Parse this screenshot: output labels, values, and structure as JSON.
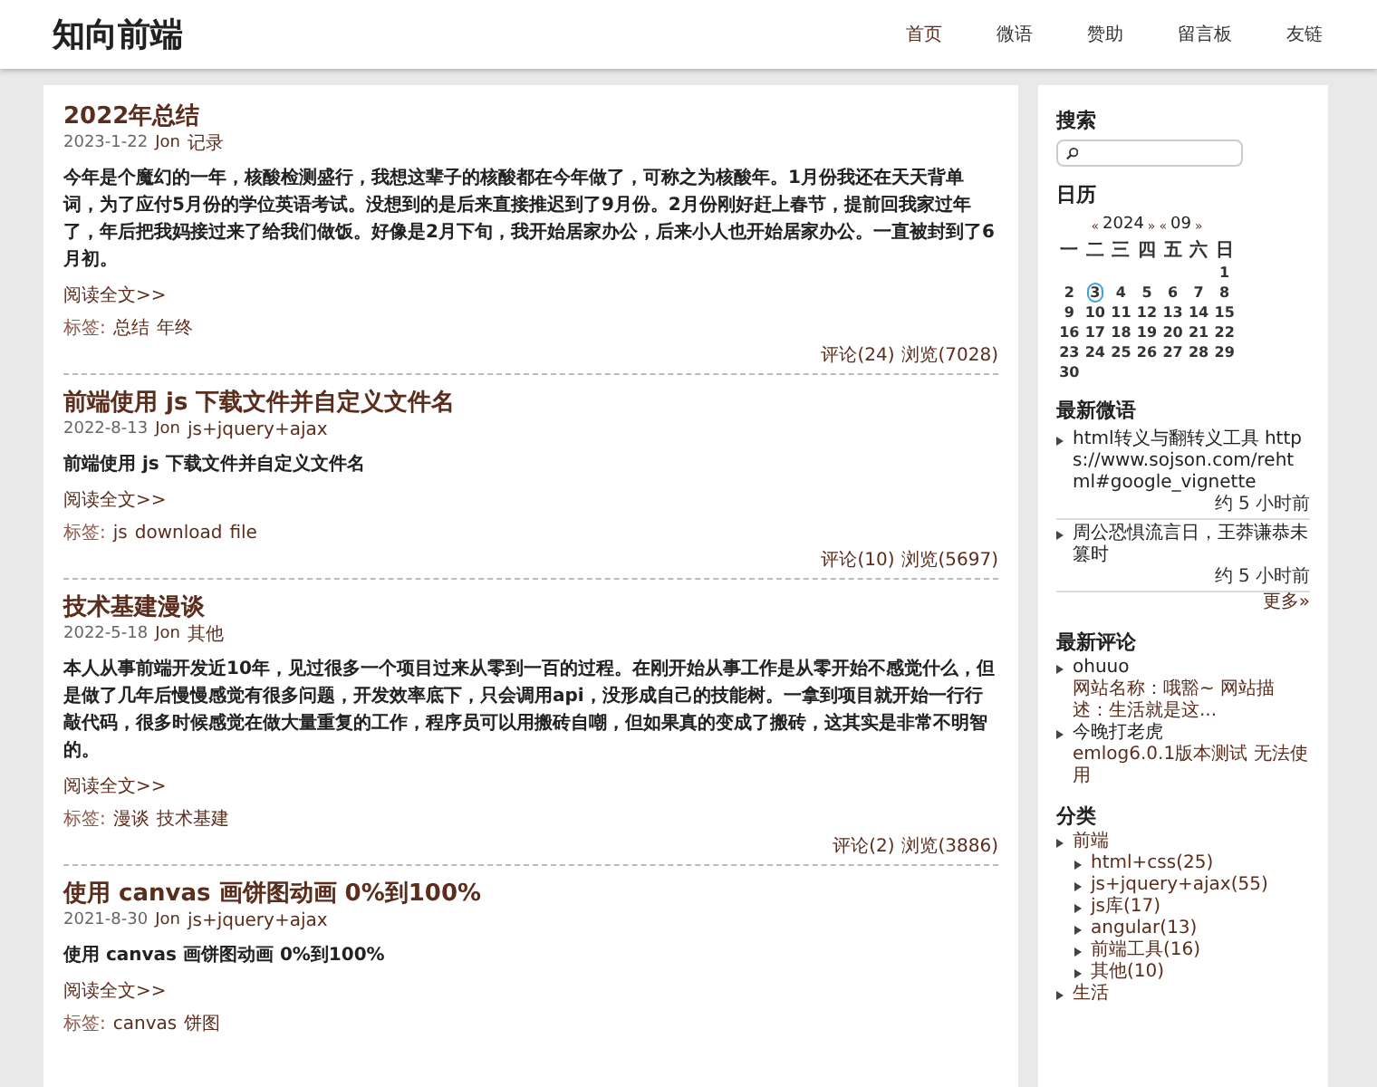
{
  "site": {
    "title": "知向前端"
  },
  "nav": [
    {
      "label": "首页",
      "selected": true
    },
    {
      "label": "微语",
      "selected": false
    },
    {
      "label": "赞助",
      "selected": false
    },
    {
      "label": "留言板",
      "selected": false
    },
    {
      "label": "友链",
      "selected": false
    }
  ],
  "posts": [
    {
      "title": "2022年总结",
      "date": "2023-1-22",
      "author": "Jon",
      "category": "记录",
      "excerpt": "今年是个魔幻的一年，核酸检测盛行，我想这辈子的核酸都在今年做了，可称之为核酸年。1月份我还在天天背单词，为了应付5月份的学位英语考试。没想到的是后来直接推迟到了9月份。2月份刚好赶上春节，提前回我家过年了，年后把我妈接过来了给我们做饭。好像是2月下旬，我开始居家办公，后来小人也开始居家办公。一直被封到了6月初。",
      "read_more": "阅读全文>>",
      "tags_label": "标签:",
      "tags": [
        "总结",
        "年终"
      ],
      "comments": "评论(24)",
      "views": "浏览(7028)"
    },
    {
      "title": "前端使用 js 下载文件并自定义文件名",
      "date": "2022-8-13",
      "author": "Jon",
      "category": "js+jquery+ajax",
      "excerpt": "前端使用 js 下载文件并自定义文件名",
      "read_more": "阅读全文>>",
      "tags_label": "标签:",
      "tags": [
        "js",
        "download",
        "file"
      ],
      "comments": "评论(10)",
      "views": "浏览(5697)"
    },
    {
      "title": "技术基建漫谈",
      "date": "2022-5-18",
      "author": "Jon",
      "category": "其他",
      "excerpt": "本人从事前端开发近10年，见过很多一个项目过来从零到一百的过程。在刚开始从事工作是从零开始不感觉什么，但是做了几年后慢慢感觉有很多问题，开发效率底下，只会调用api，没形成自己的技能树。一拿到项目就开始一行行敲代码，很多时候感觉在做大量重复的工作，程序员可以用搬砖自嘲，但如果真的变成了搬砖，这其实是非常不明智的。",
      "read_more": "阅读全文>>",
      "tags_label": "标签:",
      "tags": [
        "漫谈",
        "技术基建"
      ],
      "comments": "评论(2)",
      "views": "浏览(3886)"
    },
    {
      "title": "使用 canvas 画饼图动画 0%到100%",
      "date": "2021-8-30",
      "author": "Jon",
      "category": "js+jquery+ajax",
      "excerpt": "使用 canvas 画饼图动画 0%到100%",
      "read_more": "阅读全文>>",
      "tags_label": "标签:",
      "tags": [
        "canvas",
        "饼图"
      ]
    }
  ],
  "sidebar": {
    "search": {
      "title": "搜索"
    },
    "calendar": {
      "title": "日历",
      "prev_year": "«",
      "year": "2024",
      "next_year": "»",
      "prev_month": "«",
      "month": "09",
      "next_month": "»",
      "weekdays": [
        "一",
        "二",
        "三",
        "四",
        "五",
        "六",
        "日"
      ],
      "weeks": [
        [
          {
            "day": "1",
            "selected": false
          }
        ],
        [
          {
            "day": "2",
            "selected": false
          },
          {
            "day": "3",
            "selected": true
          },
          {
            "day": "4",
            "selected": false
          },
          {
            "day": "5",
            "selected": false
          },
          {
            "day": "6",
            "selected": false
          },
          {
            "day": "7",
            "selected": false
          },
          {
            "day": "8",
            "selected": false
          }
        ],
        [
          {
            "day": "9",
            "selected": false
          },
          {
            "day": "10",
            "selected": false
          },
          {
            "day": "11",
            "selected": false
          },
          {
            "day": "12",
            "selected": false
          },
          {
            "day": "13",
            "selected": false
          },
          {
            "day": "14",
            "selected": false
          },
          {
            "day": "15",
            "selected": false
          }
        ],
        [
          {
            "day": "16",
            "selected": false
          },
          {
            "day": "17",
            "selected": false
          },
          {
            "day": "18",
            "selected": false
          },
          {
            "day": "19",
            "selected": false
          },
          {
            "day": "20",
            "selected": false
          },
          {
            "day": "21",
            "selected": false
          },
          {
            "day": "22",
            "selected": false
          }
        ],
        [
          {
            "day": "23",
            "selected": false
          },
          {
            "day": "24",
            "selected": false
          },
          {
            "day": "25",
            "selected": false
          },
          {
            "day": "26",
            "selected": false
          },
          {
            "day": "27",
            "selected": false
          },
          {
            "day": "28",
            "selected": false
          },
          {
            "day": "29",
            "selected": false
          }
        ],
        [
          {
            "day": "30",
            "selected": false
          }
        ]
      ]
    },
    "twitter": {
      "title": "最新微语",
      "items": [
        {
          "text": "html转义与翻转义工具 https://www.sojson.com/rehtml#google_vignette",
          "time": "约 5 小时前"
        },
        {
          "text": "周公恐惧流言日，王莽谦恭未篡时",
          "time": "约 5 小时前"
        }
      ],
      "more": "更多»"
    },
    "comments": {
      "title": "最新评论",
      "items": [
        {
          "author": "ohuuo",
          "text": "网站名称：哦豁~ 网站描述：生活就是这..."
        },
        {
          "author": "今晚打老虎",
          "text": "emlog6.0.1版本测试 无法使用"
        }
      ]
    },
    "categories": {
      "title": "分类",
      "items": [
        {
          "label": "前端",
          "children": [
            {
              "label": "html+css(25)"
            },
            {
              "label": "js+jquery+ajax(55)"
            },
            {
              "label": "js库(17)"
            },
            {
              "label": "angular(13)"
            },
            {
              "label": "前端工具(16)"
            },
            {
              "label": "其他(10)"
            }
          ]
        },
        {
          "label": "生活"
        }
      ]
    }
  }
}
